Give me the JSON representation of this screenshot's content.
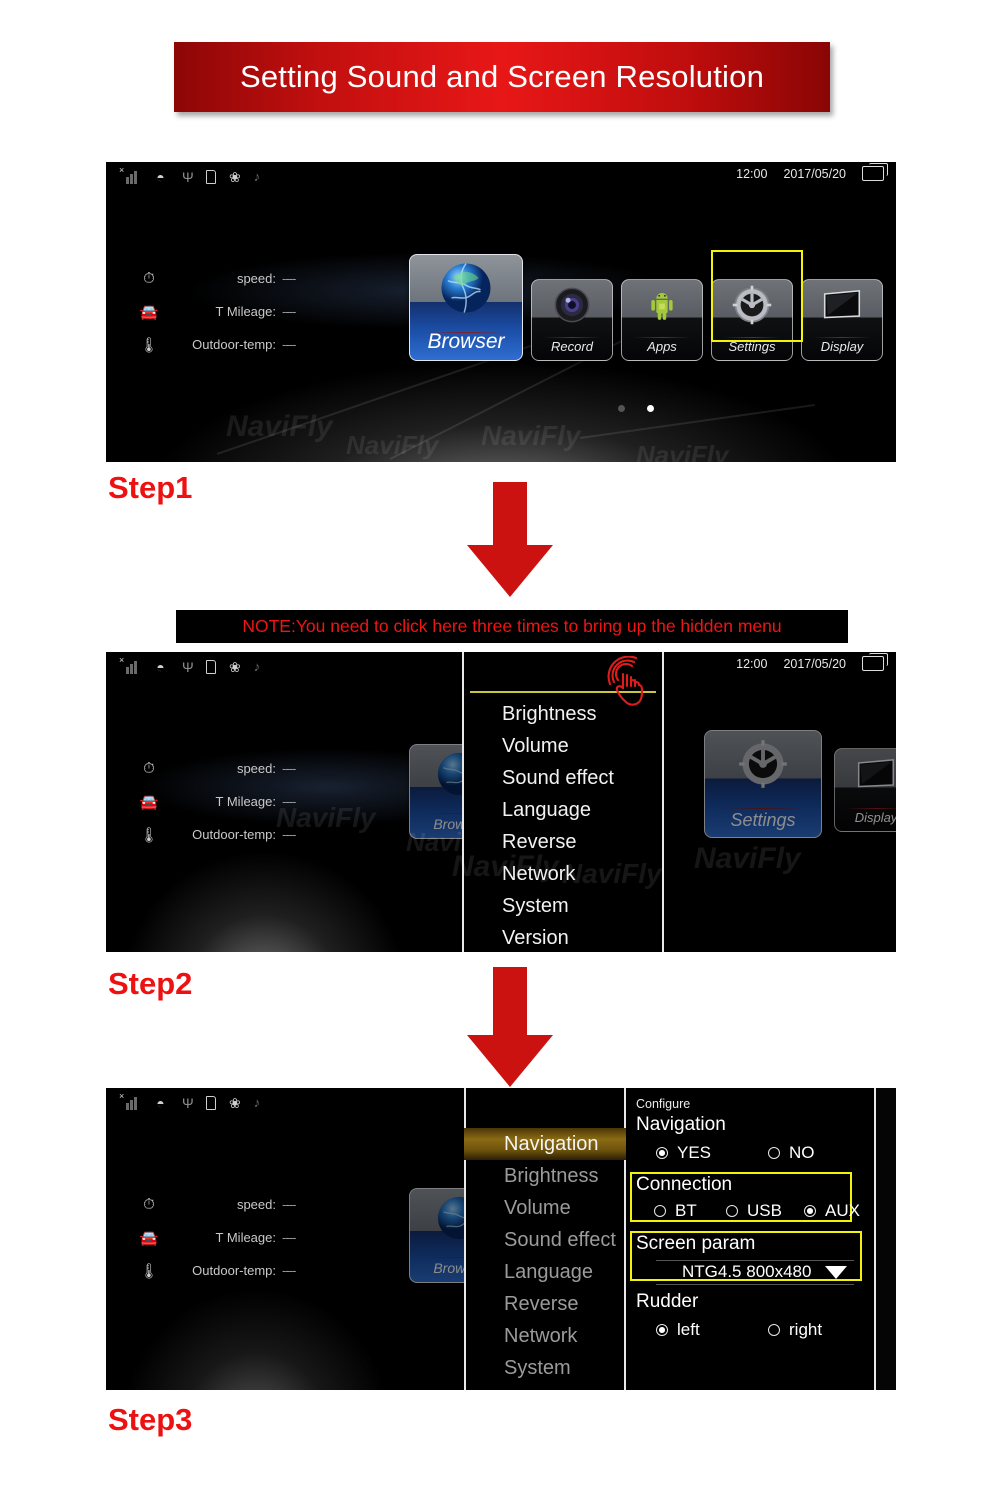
{
  "title": "Setting Sound and Screen Resolution",
  "note": "NOTE:You need to click here three times to bring up the hidden menu",
  "steps": {
    "step1": "Step1",
    "step2": "Step2",
    "step3": "Step3"
  },
  "statusbar": {
    "time": "12:00",
    "date": "2017/05/20",
    "icons": [
      "signal-icon",
      "wifi-icon",
      "usb-icon",
      "sdcard-icon",
      "bluetooth-icon",
      "mute-icon",
      "window-icon"
    ]
  },
  "vehicle_info": [
    {
      "icon": "speedometer-icon",
      "label": "speed:",
      "value": "----"
    },
    {
      "icon": "car-icon",
      "label": "T Mileage:",
      "value": "----"
    },
    {
      "icon": "thermometer-icon",
      "label": "Outdoor-temp:",
      "value": "----"
    }
  ],
  "home_tiles": [
    {
      "label": "Browser",
      "icon": "globe-icon",
      "selected": true,
      "highlighted": false
    },
    {
      "label": "Record",
      "icon": "camera-icon",
      "selected": false,
      "highlighted": false
    },
    {
      "label": "Apps",
      "icon": "android-icon",
      "selected": false,
      "highlighted": false
    },
    {
      "label": "Settings",
      "icon": "gear-icon",
      "selected": false,
      "highlighted": true
    },
    {
      "label": "Display",
      "icon": "monitor-icon",
      "selected": false,
      "highlighted": false
    }
  ],
  "step2_tiles": [
    {
      "label": "Settings",
      "icon": "gear-icon",
      "selected": true
    },
    {
      "label": "Display",
      "icon": "monitor-icon",
      "selected": false
    }
  ],
  "hidden_menu": {
    "items": [
      "Brightness",
      "Volume",
      "Sound effect",
      "Language",
      "Reverse",
      "Network",
      "System",
      "Version"
    ]
  },
  "settings_menu": {
    "items": [
      {
        "label": "Navigation",
        "active": true
      },
      {
        "label": "Brightness",
        "active": false
      },
      {
        "label": "Volume",
        "active": false
      },
      {
        "label": "Sound effect",
        "active": false
      },
      {
        "label": "Language",
        "active": false
      },
      {
        "label": "Reverse",
        "active": false
      },
      {
        "label": "Network",
        "active": false
      },
      {
        "label": "System",
        "active": false
      }
    ]
  },
  "configure": {
    "header": "Configure",
    "navigation": {
      "label": "Navigation",
      "options": [
        {
          "label": "YES",
          "selected": true
        },
        {
          "label": "NO",
          "selected": false
        }
      ]
    },
    "connection": {
      "label": "Connection",
      "options": [
        {
          "label": "BT",
          "selected": false
        },
        {
          "label": "USB",
          "selected": false
        },
        {
          "label": "AUX",
          "selected": true
        }
      ]
    },
    "screen_param": {
      "label": "Screen param",
      "value": "NTG4.5  800x480"
    },
    "rudder": {
      "label": "Rudder",
      "options": [
        {
          "label": "left",
          "selected": true
        },
        {
          "label": "right",
          "selected": false
        }
      ]
    }
  },
  "watermark": "NaviFly",
  "colors": {
    "accent_red": "#ee1111",
    "banner_red": "#c20f0f",
    "highlight_yellow": "#f2f20c",
    "tile_blue": "#1b4fa8"
  }
}
